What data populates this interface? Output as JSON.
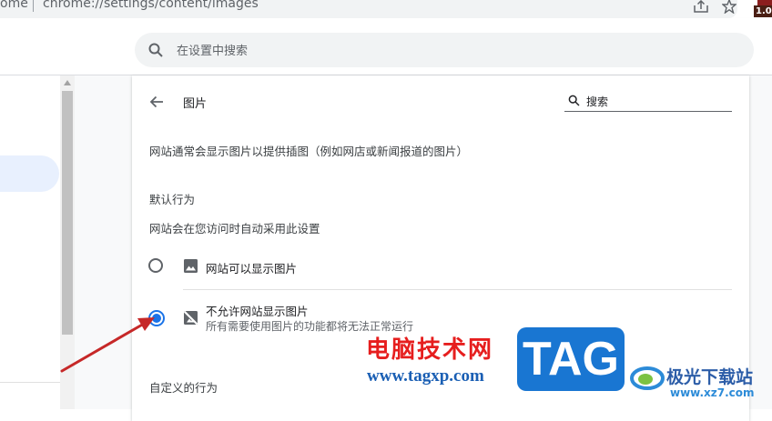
{
  "browser": {
    "url_prefix": "ome",
    "url_path": "chrome://settings/content/images",
    "extension_badge": "1.00"
  },
  "settings_search": {
    "placeholder": "在设置中搜索"
  },
  "page": {
    "title": "图片",
    "search_label": "搜索",
    "description": "网站通常会显示图片以提供插图（例如网店或新闻报道的图片）",
    "default_behavior": {
      "heading": "默认行为",
      "subtext": "网站会在您访问时自动采用此设置",
      "options": [
        {
          "label": "网站可以显示图片",
          "selected": false,
          "icon": "image-icon"
        },
        {
          "label": "不允许网站显示图片",
          "description": "所有需要使用图片的功能都将无法正常运行",
          "selected": true,
          "icon": "image-off-icon"
        }
      ]
    },
    "custom_behavior_heading": "自定义的行为"
  },
  "watermark": {
    "site_name": "电脑技术网",
    "site_url": "www.tagxp.com",
    "logo_text": "TAG",
    "secondary_name": "极光下载站",
    "secondary_url": "www.xz7.com"
  },
  "colors": {
    "accent": "#1a73e8",
    "nav_highlight": "#e8f0fe",
    "annotation_arrow": "#c62828",
    "watermark_red": "#e61e1e",
    "tag_blue": "#1976d2"
  }
}
